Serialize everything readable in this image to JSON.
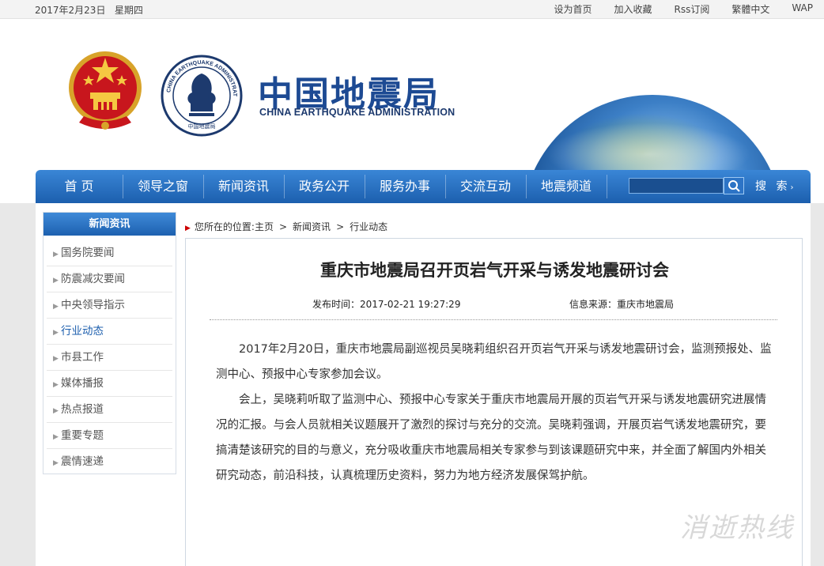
{
  "topbar": {
    "date": "2017年2月23日",
    "weekday": "星期四",
    "links": [
      "设为首页",
      "加入收藏",
      "Rss订阅",
      "繁體中文",
      "WAP"
    ]
  },
  "header": {
    "title": "中国地震局",
    "subtitle": "CHINA EARTHQUAKE ADMINISTRATION",
    "logo_ring_text": "CHINA EARTHQUAKE ADMINISTRATION",
    "logo_bottom_text": "中国地震局"
  },
  "nav": {
    "items": [
      "首 页",
      "领导之窗",
      "新闻资讯",
      "政务公开",
      "服务办事",
      "交流互动",
      "地震频道"
    ],
    "search_label": "搜 索",
    "search_value": ""
  },
  "sidebar": {
    "title": "新闻资讯",
    "items": [
      "国务院要闻",
      "防震减灾要闻",
      "中央领导指示",
      "行业动态",
      "市县工作",
      "媒体播报",
      "热点报道",
      "重要专题",
      "震情速递"
    ],
    "active": "行业动态"
  },
  "breadcrumb": {
    "prefix": "您所在的位置:",
    "items": [
      "主页",
      "新闻资讯",
      "行业动态"
    ]
  },
  "article": {
    "title": "重庆市地震局召开页岩气开采与诱发地震研讨会",
    "publish_time": "发布时间：2017-02-21 19:27:29",
    "source": "信息来源：重庆市地震局",
    "paragraphs": [
      "2017年2月20日，重庆市地震局副巡视员吴晓莉组织召开页岩气开采与诱发地震研讨会，监测预报处、监测中心、预报中心专家参加会议。",
      "会上，吴晓莉听取了监测中心、预报中心专家关于重庆市地震局开展的页岩气开采与诱发地震研究进展情况的汇报。与会人员就相关议题展开了激烈的探讨与充分的交流。吴晓莉强调，开展页岩气诱发地震研究，要搞清楚该研究的目的与意义，充分吸收重庆市地震局相关专家参与到该课题研究中来，并全面了解国内外相关研究动态，前沿科技，认真梳理历史资料，努力为地方经济发展保驾护航。"
    ]
  },
  "watermark": "消逝热线"
}
